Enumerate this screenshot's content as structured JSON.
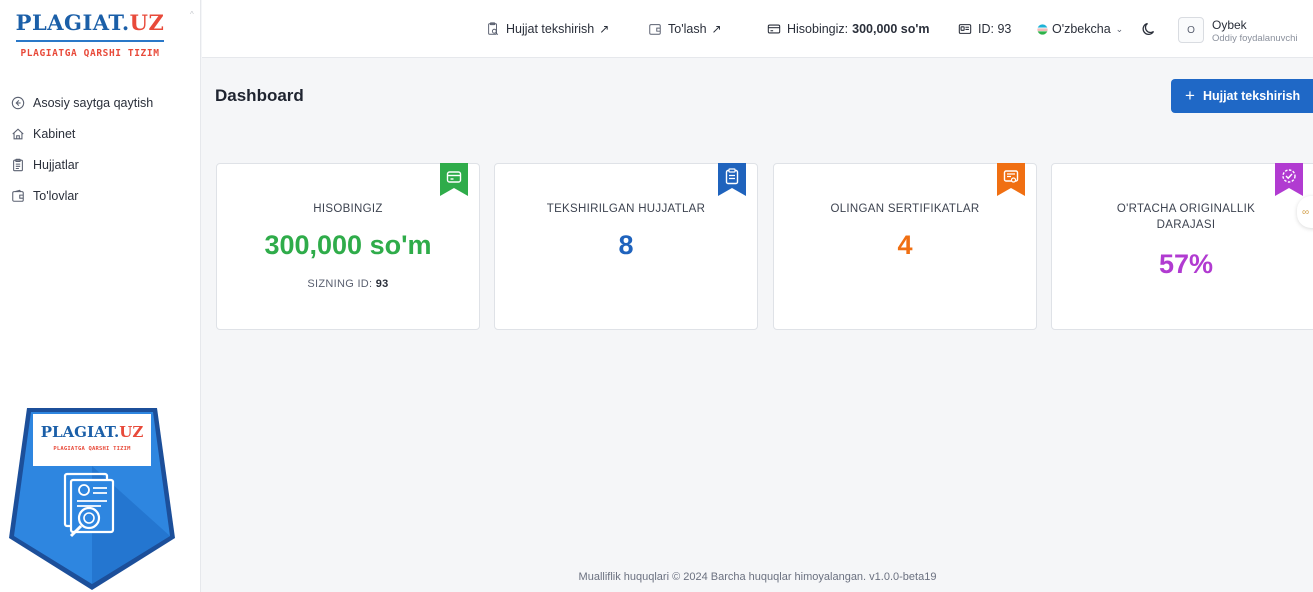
{
  "brand": {
    "name_main": "PLAGIAT.",
    "name_tld": "UZ",
    "subtitle": "PLAGIATGA QARSHI TIZIM"
  },
  "sidebar": {
    "items": [
      {
        "label": "Asosiy saytga qaytish",
        "icon": "arrow-left-circle-icon"
      },
      {
        "label": "Kabinet",
        "icon": "home-icon"
      },
      {
        "label": "Hujjatlar",
        "icon": "clipboard-icon"
      },
      {
        "label": "To'lovlar",
        "icon": "wallet-icon"
      }
    ]
  },
  "badge": {
    "name_main": "PLAGIAT.",
    "name_tld": "UZ",
    "subtitle": "PLAGIATGA QARSHI TIZIM"
  },
  "topbar": {
    "check_link": "Hujjat tekshirish",
    "pay_link": "To'lash",
    "balance_label": "Hisobingiz:",
    "balance_value": "300,000 so'm",
    "id_text": "ID: 93",
    "language": "O'zbekcha",
    "user_initial": "O",
    "user_name": "Oybek",
    "user_role": "Oddiy foydalanuvchi"
  },
  "main": {
    "title": "Dashboard",
    "primary_button": "Hujjat tekshirish",
    "cards": [
      {
        "label": "HISOBINGIZ",
        "value": "300,000 so'm",
        "foot_label": "SIZNING ID:",
        "foot_value": "93",
        "color": "#2fac4a"
      },
      {
        "label": "TEKSHIRILGAN HUJJATLAR",
        "value": "8",
        "color": "#1f63bd"
      },
      {
        "label": "OLINGAN SERTIFIKATLAR",
        "value": "4",
        "color": "#f06f12"
      },
      {
        "label_line1": "O'RTACHA ORIGINALLIK",
        "label_line2": "DARAJASI",
        "value": "57%",
        "color": "#b13bd1"
      }
    ]
  },
  "footer": {
    "text": "Mualliflik huquqlari © 2024 Barcha huquqlar himoyalangan. v1.0.0-beta19"
  }
}
